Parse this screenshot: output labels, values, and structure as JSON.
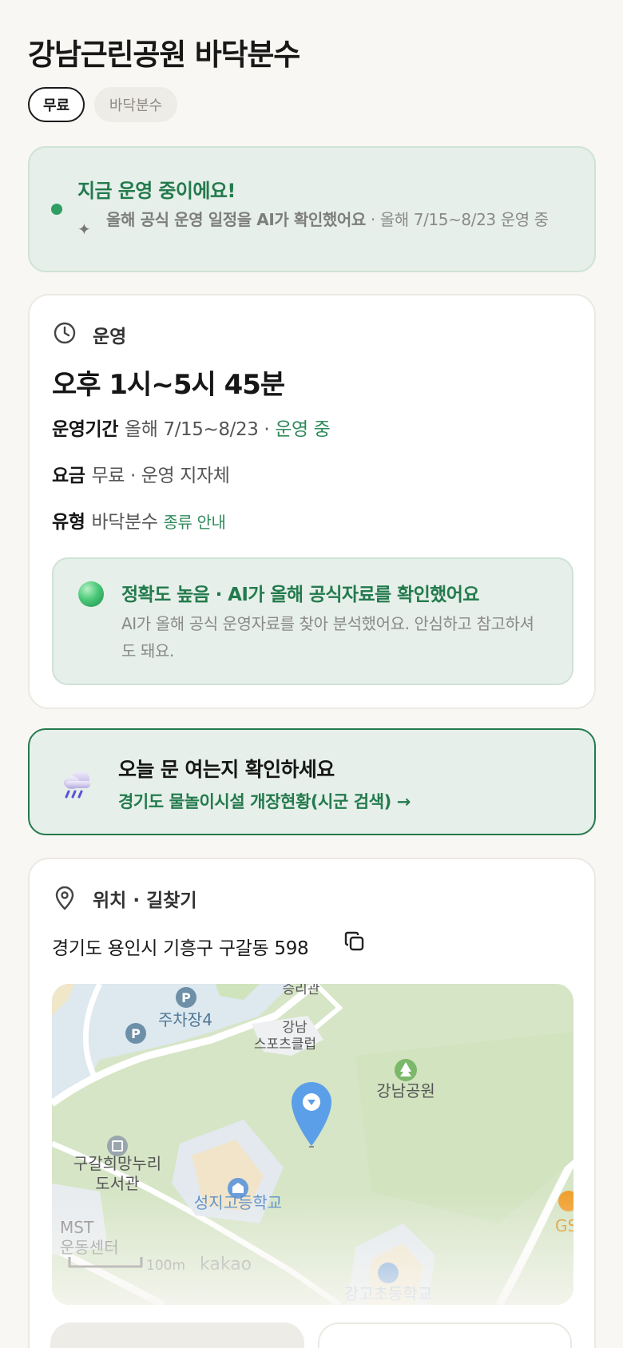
{
  "page": {
    "title": "강남근린공원 바닥분수",
    "tags": [
      "무료",
      "바닥분수"
    ]
  },
  "status": {
    "title": "지금 운영 중이에요!",
    "desc_bold": "올해 공식 운영 일정을 AI가 확인했어요",
    "desc_rest": " · 올해 7/15~8/23 운영 중"
  },
  "operation": {
    "label": "운영",
    "hours": "오후 1시~5시 45분",
    "period_key": "운영기간",
    "period_value": "올해 7/15~8/23 ·",
    "period_status": "운영 중",
    "fee_key": "요금",
    "fee_value": "무료 · 운영 지자체",
    "type_key": "유형",
    "type_value": "바닥분수",
    "type_link": "종류 안내"
  },
  "accuracy": {
    "title": "정확도 높음 · AI가 올해 공식자료를 확인했어요",
    "desc": "AI가 올해 공식 운영자료를 찾아 분석했어요. 안심하고 참고하셔도 돼요."
  },
  "check": {
    "title": "오늘 문 여는지 확인하세요",
    "link": "경기도 물놀이시설 개장현황(시군 검색) →"
  },
  "location": {
    "label": "위치 · 길찾기",
    "address": "경기도 용인시 기흥구 구갈동 598",
    "map_labels": {
      "parking": "주차장4",
      "sports": "강남",
      "sports2": "스포츠클럽",
      "top": "승리관",
      "park": "강남공원",
      "library1": "구갈희망누리",
      "library2": "도서관",
      "school": "성지고등학교",
      "mst1": "MST",
      "mst2": "운동센터",
      "scale": "100m",
      "brand": "kakao",
      "bottom_school": "강고초등학교",
      "gs": "GS",
      "p": "P"
    }
  },
  "colors": {
    "accent": "#237a4d",
    "accent_light": "#e6efe9",
    "background": "#f8f7f3"
  }
}
